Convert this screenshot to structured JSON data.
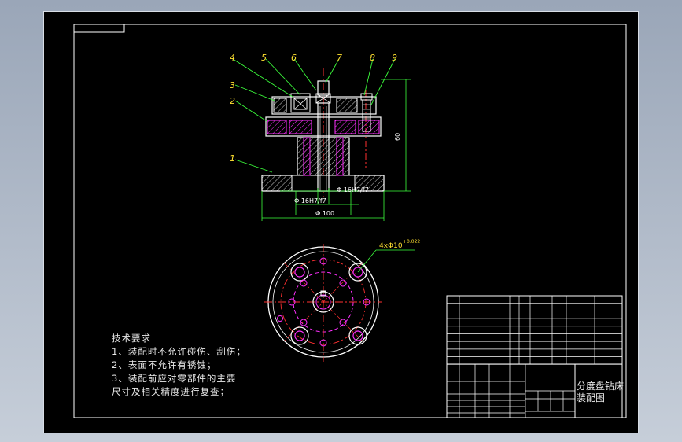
{
  "balloons": [
    "1",
    "2",
    "3",
    "4",
    "5",
    "6",
    "7",
    "8",
    "9"
  ],
  "dimensions": {
    "height": "60",
    "d1": "Φ 16H7/f7",
    "d2": "Φ 16H7/f7",
    "d3": "Φ 100",
    "holes": "4xΦ10",
    "holes_tol": "+0.022"
  },
  "notes": {
    "heading": "技术要求",
    "lines": [
      "1、装配时不允许碰伤、刮伤；",
      "2、表面不允许有锈蚀；",
      "3、装配前应对零部件的主要",
      "尺寸及相关精度进行复查；"
    ]
  },
  "title_block": {
    "name_line1": "分度盘钻床",
    "name_line2": "装配图"
  },
  "colors": {
    "frame": "#ffffff",
    "part": "#ffffff",
    "section": "#ff30ff",
    "center": "#ff3030",
    "dimension": "#3cff3c",
    "balloon": "#ffe030"
  }
}
